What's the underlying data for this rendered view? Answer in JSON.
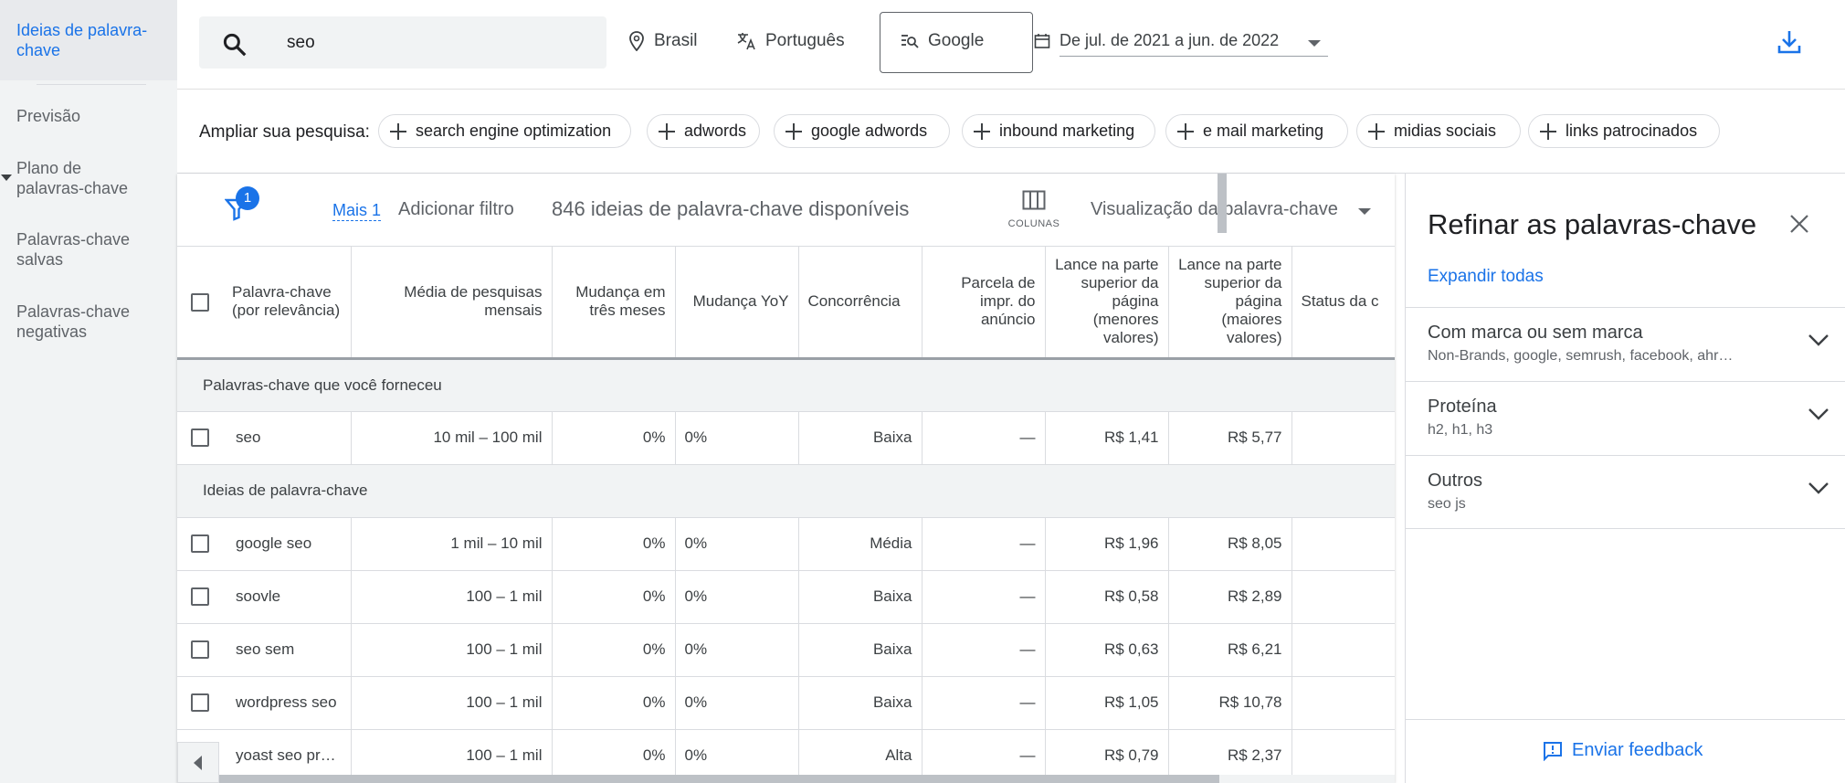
{
  "sidebar": {
    "items": [
      {
        "label": "Ideias de palavra-chave"
      },
      {
        "label": "Previsão"
      },
      {
        "label": "Plano de palavras-chave"
      },
      {
        "label": "Palavras-chave salvas"
      },
      {
        "label": "Palavras-chave negativas"
      }
    ]
  },
  "topbar": {
    "search_value": "seo",
    "location": "Brasil",
    "language": "Português",
    "engine": "Google",
    "date_range": "De jul. de 2021 a jun. de 2022"
  },
  "broaden": {
    "label": "Ampliar sua pesquisa:",
    "chips": [
      "search engine optimization",
      "adwords",
      "google adwords",
      "inbound marketing",
      "e mail marketing",
      "midias sociais",
      "links patrocinados"
    ]
  },
  "filter_bar": {
    "badge": "1",
    "more": "Mais 1",
    "add_filter": "Adicionar filtro",
    "ideas_count": "846 ideias de palavra-chave disponíveis",
    "columns": "COLUNAS",
    "view": "Visualização da palavra-chave"
  },
  "table": {
    "headers": [
      "Palavra-chave (por relevância)",
      "Média de pesquisas mensais",
      "Mudança em três meses",
      "Mudança YoY",
      "Concorrência",
      "Parcela de impr. do anúncio",
      "Lance na parte superior da página (menores valores)",
      "Lance na parte superior da página (maiores valores)",
      "Status da c"
    ],
    "group1": "Palavras-chave que você forneceu",
    "group2": "Ideias de palavra-chave",
    "provided": [
      [
        "seo",
        "10 mil – 100 mil",
        "0%",
        "0%",
        "Baixa",
        "—",
        "R$ 1,41",
        "R$ 5,77",
        ""
      ]
    ],
    "ideas": [
      [
        "google seo",
        "1 mil – 10 mil",
        "0%",
        "0%",
        "Média",
        "—",
        "R$ 1,96",
        "R$ 8,05",
        ""
      ],
      [
        "soovle",
        "100 – 1 mil",
        "0%",
        "0%",
        "Baixa",
        "—",
        "R$ 0,58",
        "R$ 2,89",
        ""
      ],
      [
        "seo sem",
        "100 – 1 mil",
        "0%",
        "0%",
        "Baixa",
        "—",
        "R$ 0,63",
        "R$ 6,21",
        ""
      ],
      [
        "wordpress seo",
        "100 – 1 mil",
        "0%",
        "0%",
        "Baixa",
        "—",
        "R$ 1,05",
        "R$ 10,78",
        ""
      ],
      [
        "yoast seo pr…",
        "100 – 1 mil",
        "0%",
        "0%",
        "Alta",
        "—",
        "R$ 0,79",
        "R$ 2,37",
        ""
      ]
    ]
  },
  "refine": {
    "title": "Refinar as palavras-chave",
    "expand_all": "Expandir todas",
    "sections": [
      {
        "title": "Com marca ou sem marca",
        "sub": "Non-Brands, google, semrush, facebook, ahr…"
      },
      {
        "title": "Proteína",
        "sub": "h2, h1, h3"
      },
      {
        "title": "Outros",
        "sub": "seo js"
      }
    ],
    "feedback": "Enviar feedback"
  },
  "colors": {
    "accent": "#1a73e8",
    "sidebar_bg": "#f1f3f4"
  }
}
